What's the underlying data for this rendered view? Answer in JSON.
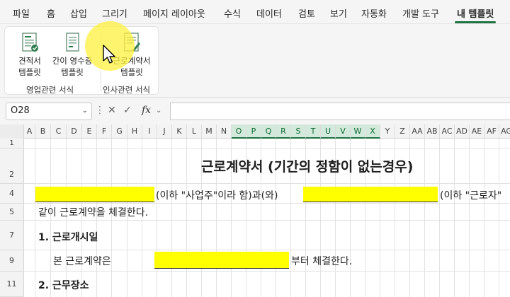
{
  "ribbon_tabs": [
    "파일",
    "홈",
    "삽입",
    "그리기",
    "페이지 레이아웃",
    "수식",
    "데이터",
    "검토",
    "보기",
    "자동화",
    "개발 도구",
    "내 템플릿"
  ],
  "active_tab": "내 템플릿",
  "ribbon": {
    "buttons": [
      {
        "line1": "견적서",
        "line2": "템플릿",
        "icon": "quote-template-icon"
      },
      {
        "line1": "간이 영수증",
        "line2": "템플릿",
        "icon": "receipt-template-icon"
      },
      {
        "line1": "근로계약서",
        "line2": "템플릿",
        "icon": "contract-template-icon"
      }
    ],
    "groups": [
      "영업관련 서식",
      "인사관련 서식"
    ]
  },
  "formula_bar": {
    "name_box": "O28",
    "fx_label": "fx",
    "formula": ""
  },
  "columns": [
    "A",
    "B",
    "C",
    "D",
    "E",
    "F",
    "G",
    "H",
    "I",
    "J",
    "K",
    "L",
    "M",
    "N",
    "O",
    "P",
    "Q",
    "R",
    "S",
    "T",
    "U",
    "V",
    "W",
    "X",
    "Y",
    "Z",
    "AA",
    "AB",
    "AC",
    "AD",
    "AE",
    "AF",
    "AG"
  ],
  "selected_columns": [
    "O",
    "P",
    "Q",
    "R",
    "S",
    "T",
    "U",
    "V",
    "W",
    "X"
  ],
  "rows": [
    "1",
    "2",
    "4",
    "5",
    "7",
    "9",
    "11"
  ],
  "sheet": {
    "title": "근로계약서 (기간의 정함이 없는경우)",
    "row4_text1": "(이하 \"사업주\"이라 함)과(와)",
    "row4_text2": "(이하 \"근로자\"",
    "row5_text": "같이 근로계약을 체결한다.",
    "section1": "1. 근로개시일",
    "row9_text1": "본 근로계약은",
    "row9_text2": "부터 체결한다.",
    "section2": "2. 근무장소"
  },
  "colors": {
    "accent": "#217346",
    "highlight": "#ffff00"
  }
}
